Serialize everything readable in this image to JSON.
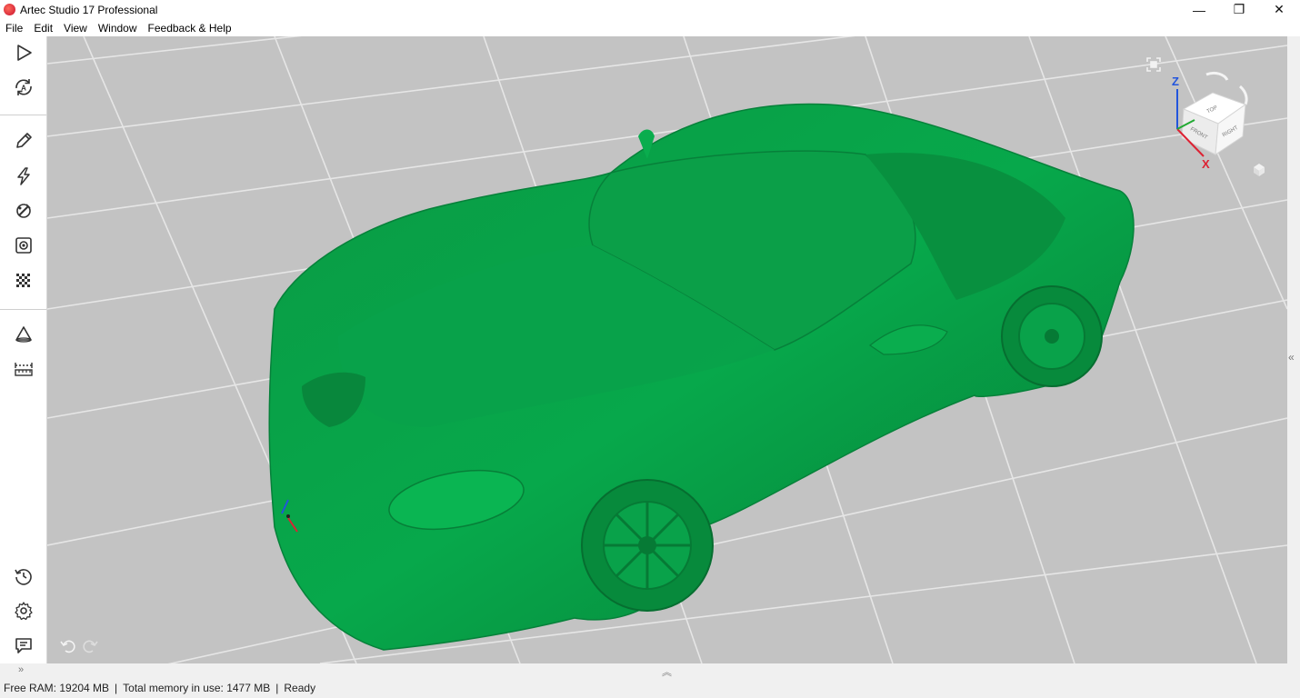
{
  "window": {
    "title": "Artec Studio 17 Professional",
    "minimize_glyph": "—",
    "restore_glyph": "❐",
    "close_glyph": "✕"
  },
  "menu": [
    "File",
    "Edit",
    "View",
    "Window",
    "Feedback & Help"
  ],
  "toolbar": {
    "items": [
      "play-icon",
      "autopilot-icon",
      "pencil-icon",
      "lightning-icon",
      "tools-icon",
      "target-icon",
      "texture-icon",
      "cone-icon",
      "ruler-icon",
      "history-icon",
      "settings-icon",
      "chat-icon"
    ],
    "autopilot_letter": "A"
  },
  "viewport": {
    "model_color": "#08a84a",
    "background_color": "#c3c3c3",
    "grid_color": "#e6e6e6",
    "nav_cube": {
      "faces": [
        "TOP",
        "FRONT",
        "RIGHT"
      ],
      "axis_z": "Z",
      "axis_x": "X"
    },
    "undo_icon": "undo-icon",
    "redo_icon": "redo-icon"
  },
  "panels": {
    "bottom_toggle": "»",
    "bottom_center_toggle": "︽",
    "right_toggle": "«"
  },
  "status": {
    "free_ram": "Free RAM: 19204 MB",
    "memory": "Total memory in use: 1477 MB",
    "separator": "|",
    "state": "Ready"
  }
}
